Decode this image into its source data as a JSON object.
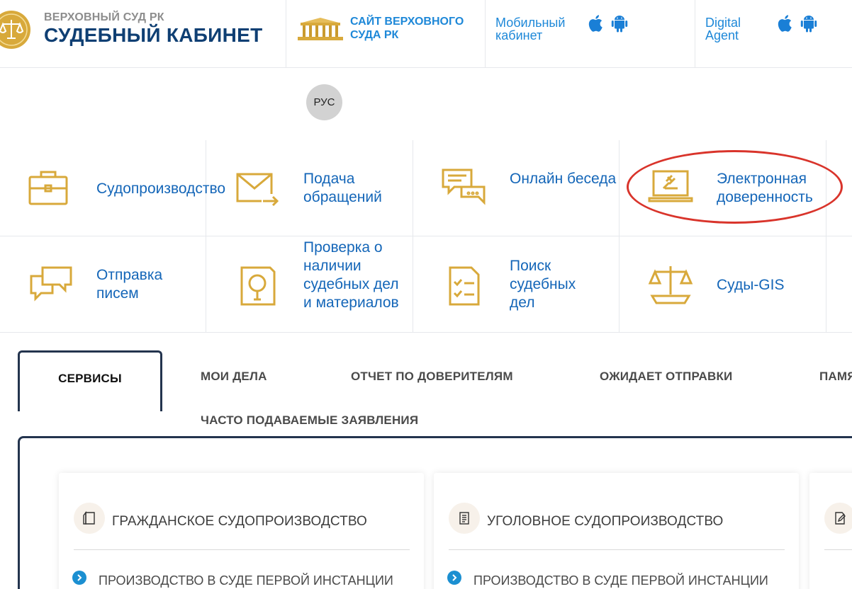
{
  "header": {
    "brand_small": "ВЕРХОВНЫЙ СУД РК",
    "brand_large": "СУДЕБНЫЙ КАБИНЕТ",
    "court_site_line1": "САЙТ ВЕРХОВНОГО",
    "court_site_line2": "СУДА РК",
    "mobile_line1": "Мобильный",
    "mobile_line2": "кабинет",
    "agent_line1": "Digital",
    "agent_line2": "Agent",
    "icons": [
      "court-emblem-icon",
      "court-building-icon",
      "apple-icon",
      "android-icon"
    ]
  },
  "language": {
    "current": "РУС"
  },
  "services": [
    {
      "icon": "briefcase-icon",
      "label": "Судопроизводство"
    },
    {
      "icon": "envelope-icon",
      "label": "Подача обращений"
    },
    {
      "icon": "chat-icon",
      "label": "Онлайн беседа"
    },
    {
      "icon": "laptop-gavel-icon",
      "label": "Электронная доверенность"
    },
    {
      "icon": "messages-icon",
      "label": "Отправка писем"
    },
    {
      "icon": "document-search-icon",
      "label": "Проверка о наличии судебных дел и материалов"
    },
    {
      "icon": "checklist-icon",
      "label": "Поиск судебных дел"
    },
    {
      "icon": "scales-icon",
      "label": "Суды-GIS"
    }
  ],
  "tabs": [
    {
      "label": "СЕРВИСЫ",
      "active": true
    },
    {
      "label": "МОИ ДЕЛА"
    },
    {
      "label": "ОТЧЕТ ПО ДОВЕРИТЕЛЯМ"
    },
    {
      "label": "ОЖИДАЕТ ОТПРАВКИ"
    },
    {
      "label": "ПАМЯТКИ"
    },
    {
      "label": "ЧАСТО ПОДАВАЕМЫЕ ЗАЯВЛЕНИЯ"
    }
  ],
  "cards": [
    {
      "icon": "civil-case-icon",
      "title": "ГРАЖДАНСКОЕ СУДОПРОИЗВОДСТВО",
      "item": "ПРОИЗВОДСТВО В СУДЕ ПЕРВОЙ ИНСТАНЦИИ"
    },
    {
      "icon": "criminal-case-icon",
      "title": "УГОЛОВНОЕ СУДОПРОИЗВОДСТВО",
      "item": "ПРОИЗВОДСТВО В СУДЕ ПЕРВОЙ ИНСТАНЦИИ"
    },
    {
      "icon": "document-edit-icon"
    }
  ],
  "colors": {
    "brand_navy": "#0f3f73",
    "link_blue": "#1e88d8",
    "service_blue": "#1466b8",
    "gold": "#d8a93b",
    "tab_border": "#23344e",
    "highlight_red": "#d9342b"
  }
}
